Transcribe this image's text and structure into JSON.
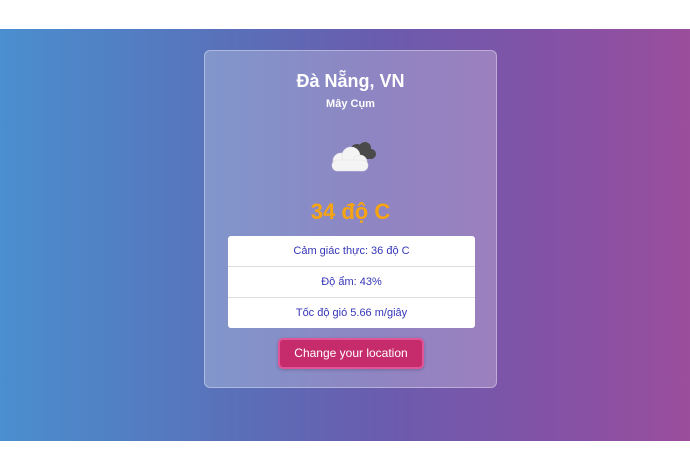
{
  "weather": {
    "location": "Đà Nẵng, VN",
    "description": "Mây Cụm",
    "icon": "broken-clouds-icon",
    "temperature": "34 độ C",
    "details": [
      "Cảm giác thực: 36 độ C",
      "Độ ẩm: 43%",
      "Tốc độ gió 5.66 m/giây"
    ],
    "change_location_label": "Change your location"
  },
  "colors": {
    "background_start": "#4a8fcf",
    "background_end": "#9a4e9c",
    "temperature": "#f6a411",
    "detail_text": "#3535b8",
    "button": "#c62b6c"
  }
}
